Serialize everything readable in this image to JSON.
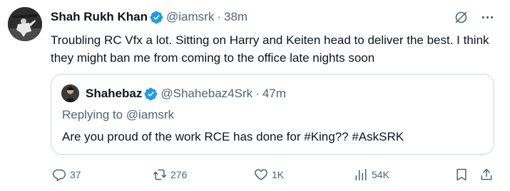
{
  "tweet": {
    "author_name": "Shah Rukh Khan",
    "handle": "@iamsrk",
    "separator": "·",
    "time": "38m",
    "text": "Troubling RC Vfx a lot. Sitting on Harry and Keiten head to deliver the best. I think they might ban me from coming to the office late nights soon"
  },
  "quote": {
    "author_name": "Shahebaz",
    "handle": "@Shahebaz4Srk",
    "separator": "·",
    "time": "47m",
    "replying_prefix": "Replying to ",
    "replying_handle": "@iamsrk",
    "text": "Are you proud of the work RCE has done for #King?? #AskSRK"
  },
  "actions": {
    "replies": "37",
    "retweets": "276",
    "likes": "1K",
    "views": "54K"
  },
  "icons": {
    "verified": "verified-badge-icon",
    "grok": "grok-icon",
    "more": "more-icon",
    "reply": "reply-icon",
    "retweet": "retweet-icon",
    "like": "heart-icon",
    "views": "views-icon",
    "bookmark": "bookmark-icon",
    "share": "share-icon"
  },
  "colors": {
    "verified_blue": "#1d9bf0",
    "text_primary": "#0f1419",
    "text_secondary": "#536471",
    "border": "#cfd9de"
  }
}
